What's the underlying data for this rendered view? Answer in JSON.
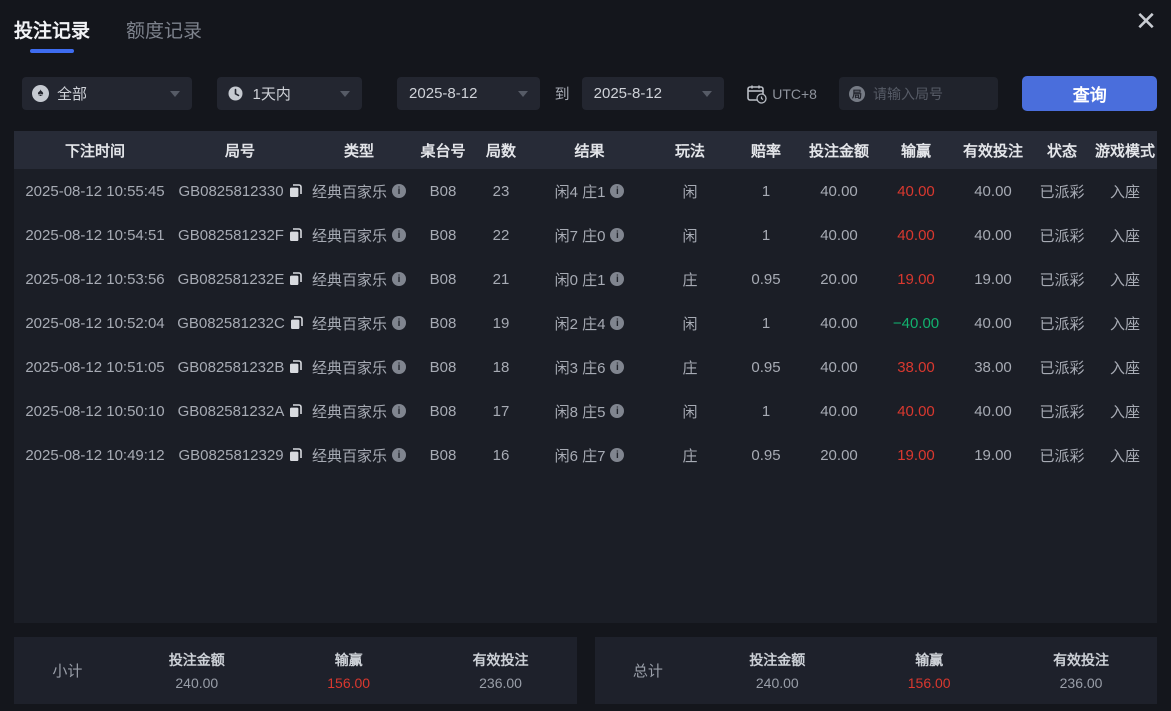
{
  "tabs": [
    {
      "label": "投注记录",
      "active": true
    },
    {
      "label": "额度记录",
      "active": false
    }
  ],
  "window": {
    "close_glyph": "✕"
  },
  "filters": {
    "game_type": {
      "value": "全部",
      "icon": "spade-circle-icon"
    },
    "time_range": {
      "value": "1天内",
      "icon": "clock-icon"
    },
    "date_from": "2025-8-12",
    "to_label": "到",
    "date_to": "2025-8-12",
    "timezone_label": "UTC+8",
    "game_no_placeholder": "请输入局号",
    "query_label": "查询"
  },
  "table": {
    "columns": [
      "下注时间",
      "局号",
      "类型",
      "桌台号",
      "局数",
      "结果",
      "玩法",
      "赔率",
      "投注金额",
      "输赢",
      "有效投注",
      "状态",
      "游戏模式"
    ],
    "rows": [
      {
        "time": "2025-08-12 10:55:45",
        "game_no": "GB0825812330",
        "type": "经典百家乐",
        "table_no": "B08",
        "rounds": "23",
        "result": "闲4 庄1",
        "play": "闲",
        "odds": "1",
        "bet_amount": "40.00",
        "win_loss": "40.00",
        "win_loss_color": "red",
        "valid_bet": "40.00",
        "status": "已派彩",
        "mode": "入座"
      },
      {
        "time": "2025-08-12 10:54:51",
        "game_no": "GB082581232F",
        "type": "经典百家乐",
        "table_no": "B08",
        "rounds": "22",
        "result": "闲7 庄0",
        "play": "闲",
        "odds": "1",
        "bet_amount": "40.00",
        "win_loss": "40.00",
        "win_loss_color": "red",
        "valid_bet": "40.00",
        "status": "已派彩",
        "mode": "入座"
      },
      {
        "time": "2025-08-12 10:53:56",
        "game_no": "GB082581232E",
        "type": "经典百家乐",
        "table_no": "B08",
        "rounds": "21",
        "result": "闲0 庄1",
        "play": "庄",
        "odds": "0.95",
        "bet_amount": "20.00",
        "win_loss": "19.00",
        "win_loss_color": "red",
        "valid_bet": "19.00",
        "status": "已派彩",
        "mode": "入座"
      },
      {
        "time": "2025-08-12 10:52:04",
        "game_no": "GB082581232C",
        "type": "经典百家乐",
        "table_no": "B08",
        "rounds": "19",
        "result": "闲2 庄4",
        "play": "闲",
        "odds": "1",
        "bet_amount": "40.00",
        "win_loss": "−40.00",
        "win_loss_color": "green",
        "valid_bet": "40.00",
        "status": "已派彩",
        "mode": "入座"
      },
      {
        "time": "2025-08-12 10:51:05",
        "game_no": "GB082581232B",
        "type": "经典百家乐",
        "table_no": "B08",
        "rounds": "18",
        "result": "闲3 庄6",
        "play": "庄",
        "odds": "0.95",
        "bet_amount": "40.00",
        "win_loss": "38.00",
        "win_loss_color": "red",
        "valid_bet": "38.00",
        "status": "已派彩",
        "mode": "入座"
      },
      {
        "time": "2025-08-12 10:50:10",
        "game_no": "GB082581232A",
        "type": "经典百家乐",
        "table_no": "B08",
        "rounds": "17",
        "result": "闲8 庄5",
        "play": "闲",
        "odds": "1",
        "bet_amount": "40.00",
        "win_loss": "40.00",
        "win_loss_color": "red",
        "valid_bet": "40.00",
        "status": "已派彩",
        "mode": "入座"
      },
      {
        "time": "2025-08-12 10:49:12",
        "game_no": "GB0825812329",
        "type": "经典百家乐",
        "table_no": "B08",
        "rounds": "16",
        "result": "闲6 庄7",
        "play": "庄",
        "odds": "0.95",
        "bet_amount": "20.00",
        "win_loss": "19.00",
        "win_loss_color": "red",
        "valid_bet": "19.00",
        "status": "已派彩",
        "mode": "入座"
      }
    ]
  },
  "summary": {
    "subtotal": {
      "label": "小计",
      "items": [
        {
          "label": "投注金额",
          "value": "240.00",
          "color": "default"
        },
        {
          "label": "输赢",
          "value": "156.00",
          "color": "red"
        },
        {
          "label": "有效投注",
          "value": "236.00",
          "color": "default"
        }
      ]
    },
    "total": {
      "label": "总计",
      "items": [
        {
          "label": "投注金额",
          "value": "240.00",
          "color": "default"
        },
        {
          "label": "输赢",
          "value": "156.00",
          "color": "red"
        },
        {
          "label": "有效投注",
          "value": "236.00",
          "color": "default"
        }
      ]
    }
  },
  "colors": {
    "accent_blue": "#4a6edc",
    "win_red": "#d9382f",
    "loss_green": "#12b16e"
  }
}
